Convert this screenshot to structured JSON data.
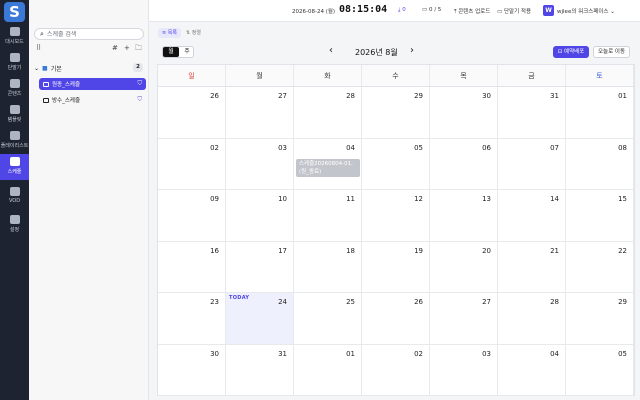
{
  "app": {
    "logo_letter": "S"
  },
  "rail": [
    {
      "label": "대시보드",
      "icon": "grid-icon"
    },
    {
      "label": "단말기",
      "icon": "monitor-icon"
    },
    {
      "label": "콘텐츠",
      "icon": "image-icon"
    },
    {
      "label": "템플릿",
      "icon": "template-icon"
    },
    {
      "label": "플레이리스트",
      "icon": "playlist-icon"
    },
    {
      "label": "스케줄",
      "icon": "calendar-icon",
      "active": true
    },
    {
      "label": "VOD",
      "icon": "vod-icon"
    },
    {
      "label": "설정",
      "icon": "gear-icon"
    }
  ],
  "panel": {
    "search_placeholder": "스케줄 검색",
    "tools": {
      "grid": "⠿",
      "hash": "#",
      "plus": "+",
      "folder_add": "🗀"
    },
    "folder": {
      "label": "기본",
      "count": "2"
    },
    "schedules": [
      {
        "label": "원종_스케줄",
        "selected": true
      },
      {
        "label": "방수_스케줄",
        "selected": false
      }
    ]
  },
  "topbar": {
    "date": "2026-08-24 (월)",
    "time": "08:15:04",
    "download_count": "0",
    "device_status": "0 / 5",
    "upload_label": "콘텐츠 업로드",
    "apply_label": "단말기 적용",
    "workspace_initial": "W",
    "workspace_name": "wjlee의 워크스페이스"
  },
  "tabs": {
    "list": "목록",
    "sort": "정렬"
  },
  "calendar": {
    "view_month": "월",
    "view_week": "주",
    "prev": "‹",
    "next": "›",
    "month_title": "2026년 8월",
    "reserve_button": "예약배포",
    "today_button": "오늘로 이동",
    "today_label": "TODAY",
    "weekdays": [
      "일",
      "월",
      "화",
      "수",
      "목",
      "금",
      "토"
    ],
    "weekday_colors": [
      "#e0453a",
      "#333333",
      "#333333",
      "#333333",
      "#333333",
      "#333333",
      "#3a5fd9"
    ],
    "weeks": [
      [
        "26",
        "27",
        "28",
        "29",
        "30",
        "31",
        "01"
      ],
      [
        "02",
        "03",
        "04",
        "05",
        "06",
        "07",
        "08"
      ],
      [
        "09",
        "10",
        "11",
        "12",
        "13",
        "14",
        "15"
      ],
      [
        "16",
        "17",
        "18",
        "19",
        "20",
        "21",
        "22"
      ],
      [
        "23",
        "24",
        "25",
        "26",
        "27",
        "28",
        "29"
      ],
      [
        "30",
        "31",
        "01",
        "02",
        "03",
        "04",
        "05"
      ]
    ],
    "event": {
      "text": "스케줄20260804-01, (원_종료)"
    }
  }
}
